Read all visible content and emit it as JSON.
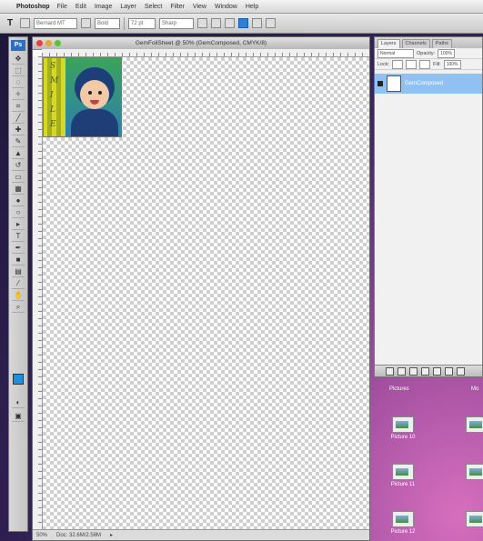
{
  "menubar": {
    "apple": "",
    "app_name": "Photoshop",
    "items": [
      "File",
      "Edit",
      "Image",
      "Layer",
      "Select",
      "Filter",
      "View",
      "Window",
      "Help"
    ]
  },
  "options_bar": {
    "tool_glyph": "T",
    "font_family": "Bernard MT",
    "font_style": "Bold",
    "font_size": "72 pt",
    "antialias": "Sharp"
  },
  "document": {
    "title": "GemFoilSheet @ 50% (GemComposed, CMYK/8)",
    "status_zoom": "50%",
    "status_doc": "Doc: 32.6M/2.58M",
    "photo_text": [
      "S",
      "M",
      "I",
      "L",
      "E"
    ]
  },
  "layers_panel": {
    "tabs": [
      "Layers",
      "Channels",
      "Paths"
    ],
    "blend_mode": "Normal",
    "opacity_label": "Opacity:",
    "opacity": "100%",
    "lock_label": "Lock:",
    "fill_label": "Fill:",
    "fill": "100%",
    "layer_name": "GemComposed"
  },
  "desktop": {
    "headers": [
      "Pictures",
      "Mo"
    ],
    "icons": [
      "Picture 10",
      "Picture 11",
      "Picture 12"
    ]
  },
  "colors": {
    "foreground": "#1e8fe0",
    "selection": "#8fc1f2",
    "accent": "#2f7fd6"
  }
}
